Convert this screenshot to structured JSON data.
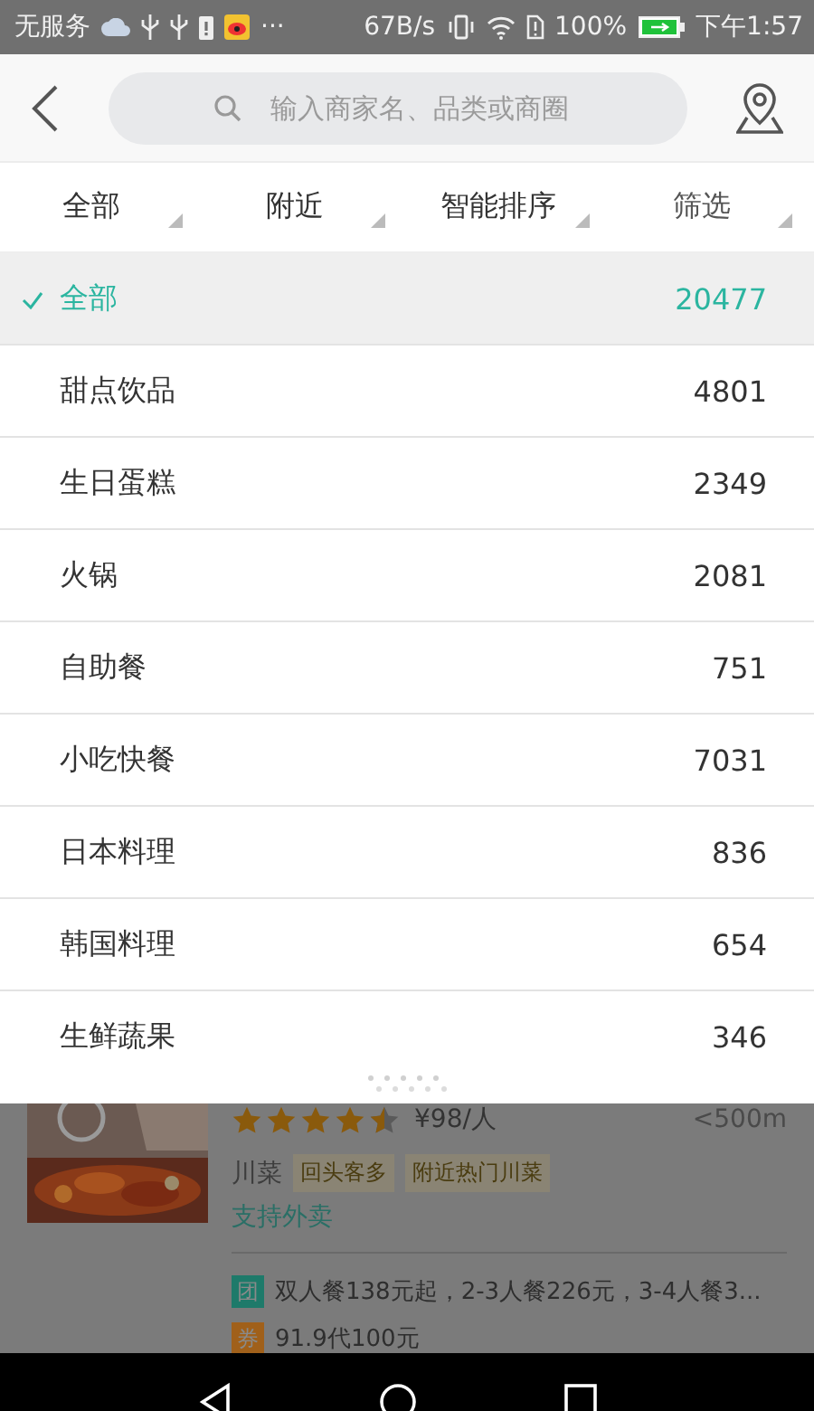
{
  "status_bar": {
    "carrier": "无服务",
    "more": "···",
    "speed": "67B/s",
    "battery": "100%",
    "time": "下午1:57"
  },
  "search": {
    "placeholder": "输入商家名、品类或商圈"
  },
  "filters": [
    {
      "label": "全部"
    },
    {
      "label": "附近"
    },
    {
      "label": "智能排序"
    },
    {
      "label": "筛选"
    }
  ],
  "categories": [
    {
      "name": "全部",
      "count": "20477",
      "selected": true
    },
    {
      "name": "甜点饮品",
      "count": "4801",
      "selected": false
    },
    {
      "name": "生日蛋糕",
      "count": "2349",
      "selected": false
    },
    {
      "name": "火锅",
      "count": "2081",
      "selected": false
    },
    {
      "name": "自助餐",
      "count": "751",
      "selected": false
    },
    {
      "name": "小吃快餐",
      "count": "7031",
      "selected": false
    },
    {
      "name": "日本料理",
      "count": "836",
      "selected": false
    },
    {
      "name": "韩国料理",
      "count": "654",
      "selected": false
    },
    {
      "name": "生鲜蔬果",
      "count": "346",
      "selected": false
    }
  ],
  "restaurant": {
    "stars": 4.5,
    "price": "¥98/人",
    "distance": "<500m",
    "cuisine": "川菜",
    "tags": [
      "回头客多",
      "附近热门川菜"
    ],
    "delivery": "支持外卖",
    "deals": [
      {
        "kind": "group",
        "badge": "团",
        "text": "双人餐138元起，2-3人餐226元，3-4人餐3..."
      },
      {
        "kind": "coupon",
        "badge": "券",
        "text": "91.9代100元"
      }
    ]
  }
}
